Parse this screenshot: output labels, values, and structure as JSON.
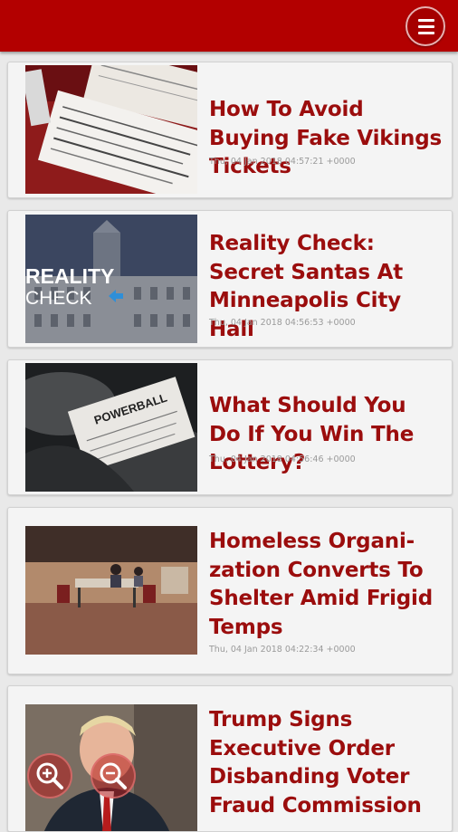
{
  "header": {
    "menu_icon": "hamburger-menu-icon",
    "color": "#b30000"
  },
  "articles": [
    {
      "title": "How To Avoid Buying Fake Vikings Tickets",
      "date": "Thu, 04 Jan 2018 04:57:21 +0000",
      "image": "vikings-tickets-photo"
    },
    {
      "title": "Reality Check: Secret Santas At Minneapolis City Hall",
      "date": "Thu, 04 Jan 2018 04:56:53 +0000",
      "image": "reality-check-city-hall-photo",
      "image_text": [
        "REALITY",
        "CHECK"
      ]
    },
    {
      "title": "What Should You Do If You Win The Lottery?",
      "date": "Thu, 04 Jan 2018 04:56:46 +0000",
      "image": "powerball-tickets-photo",
      "image_text": "POWERBALL"
    },
    {
      "title": "Homeless Organi-zation Converts To Shelter Amid Frigid Temps",
      "date": "Thu, 04 Jan 2018 04:22:34 +0000",
      "image": "shelter-room-photo"
    },
    {
      "title": "Trump Signs Executive Order Disbanding Voter Fraud Commission",
      "date": "",
      "image": "trump-photo"
    }
  ],
  "zoom_controls": {
    "zoom_in_icon": "zoom-in-icon",
    "zoom_out_icon": "zoom-out-icon"
  },
  "colors": {
    "headline": "#9b0d0d",
    "accent": "#b30000",
    "background": "#e9e9e9"
  }
}
